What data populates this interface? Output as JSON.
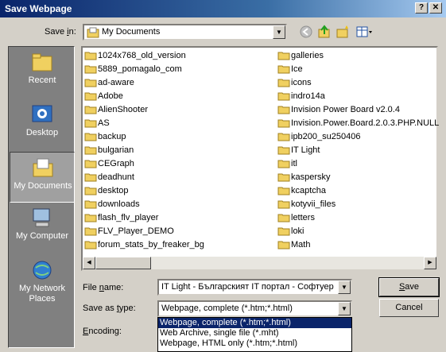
{
  "window": {
    "title": "Save Webpage",
    "help_btn": "?",
    "close_btn": "✕"
  },
  "save_in": {
    "label_pre": "Save ",
    "label_u": "i",
    "label_post": "n:",
    "value": "My Documents"
  },
  "places": [
    {
      "label": "Recent"
    },
    {
      "label": "Desktop"
    },
    {
      "label": "My Documents"
    },
    {
      "label": "My Computer"
    },
    {
      "label": "My Network Places"
    }
  ],
  "files_col1": [
    "1024x768_old_version",
    "5889_pomagalo_com",
    "ad-aware",
    "Adobe",
    "AlienShooter",
    "AS",
    "backup",
    "bulgarian",
    "CEGraph",
    "deadhunt",
    "desktop",
    "downloads",
    "flash_flv_player",
    "FLV_Player_DEMO",
    "forum_stats_by_freaker_bg"
  ],
  "files_col2": [
    "galleries",
    "Ice",
    "icons",
    "indro14a",
    "Invision Power Board v2.0.4",
    "Invision.Power.Board.2.0.3.PHP.NULL",
    "ipb200_su250406",
    "IT Light",
    "itl",
    "kaspersky",
    "kcaptcha",
    "kotyvii_files",
    "letters",
    "loki",
    "Math"
  ],
  "file_name": {
    "label_pre": "File ",
    "label_u": "n",
    "label_post": "ame:",
    "value": "IT Light - Българският IT портал - Софтуер"
  },
  "save_type": {
    "label_pre": "Save as ",
    "label_u": "t",
    "label_post": "ype:",
    "value": "Webpage, complete (*.htm;*.html)"
  },
  "encoding": {
    "label_u": "E",
    "label_post": "ncoding:"
  },
  "buttons": {
    "save_u": "S",
    "save_post": "ave",
    "cancel": "Cancel"
  },
  "type_options": [
    "Webpage, complete (*.htm;*.html)",
    "Web Archive, single file (*.mht)",
    "Webpage, HTML only (*.htm;*.html)"
  ],
  "colors": {
    "folder": "#f0d060",
    "selection": "#0a246a",
    "title_start": "#0a246a"
  }
}
